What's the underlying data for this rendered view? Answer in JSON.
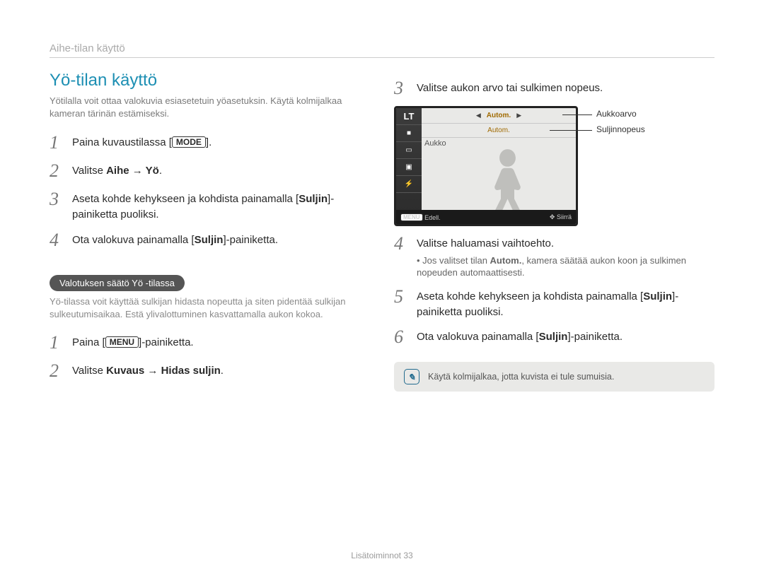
{
  "header": {
    "breadcrumb": "Aihe-tilan käyttö"
  },
  "left": {
    "title": "Yö-tilan käyttö",
    "intro": "Yötilalla voit ottaa valokuvia esiasetetuin yöasetuksin. Käytä kolmijalkaa kameran tärinän estämiseksi.",
    "steps_a": [
      {
        "n": "1",
        "pre": "Paina kuvaustilassa [",
        "key": "MODE",
        "post": "]."
      },
      {
        "n": "2",
        "pre": "Valitse ",
        "bold": "Aihe → Yö",
        "post": "."
      },
      {
        "n": "3",
        "pre": "Aseta kohde kehykseen ja kohdista painamalla [",
        "bold": "Suljin",
        "post": "]-painiketta puoliksi."
      },
      {
        "n": "4",
        "pre": "Ota valokuva painamalla [",
        "bold": "Suljin",
        "post": "]-painiketta."
      }
    ],
    "pill": "Valotuksen säätö Yö -tilassa",
    "subtext": "Yö-tilassa voit käyttää sulkijan hidasta nopeutta ja siten pidentää sulkijan sulkeutumisaikaa. Estä ylivalottuminen kasvattamalla aukon kokoa.",
    "steps_b": [
      {
        "n": "1",
        "pre": "Paina [",
        "key": "MENU",
        "post": "]-painiketta."
      },
      {
        "n": "2",
        "pre": "Valitse ",
        "bold": "Kuvaus → Hidas suljin",
        "post": "."
      }
    ]
  },
  "right": {
    "steps": [
      {
        "n": "3",
        "text": "Valitse aukon arvo tai sulkimen nopeus."
      },
      {
        "n": "4",
        "text": "Valitse haluamasi vaihtoehto.",
        "sub_pre": "Jos valitset tilan ",
        "sub_bold": "Autom.",
        "sub_post": ", kamera säätää aukon koon ja sulkimen nopeuden automaattisesti."
      },
      {
        "n": "5",
        "pre": "Aseta kohde kehykseen ja kohdista painamalla [",
        "bold": "Suljin",
        "post": "]-painiketta puoliksi."
      },
      {
        "n": "6",
        "pre": "Ota valokuva painamalla [",
        "bold": "Suljin",
        "post": "]-painiketta."
      }
    ],
    "lcd": {
      "lt": "LT",
      "autom1": "Autom.",
      "autom2": "Autom.",
      "aukko": "Aukko",
      "menu": "MENU",
      "edell": "Edell.",
      "siirra": "Siirrä",
      "legend1": "Aukkoarvo",
      "legend2": "Suljinnopeus"
    },
    "note": "Käytä kolmijalkaa, jotta kuvista ei tule sumuisia."
  },
  "footer": {
    "section": "Lisätoiminnot",
    "page": "33"
  }
}
